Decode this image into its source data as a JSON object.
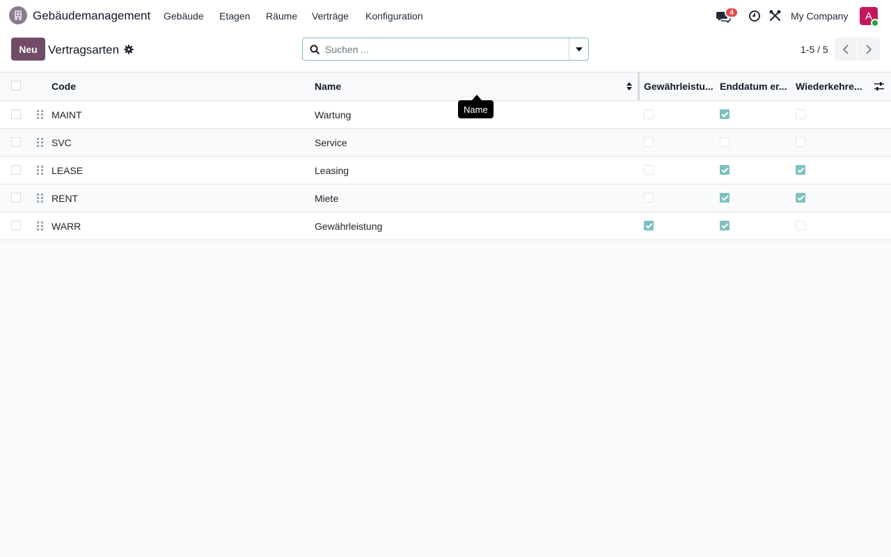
{
  "navbar": {
    "app_name": "Gebäudemanagement",
    "menu": [
      "Gebäude",
      "Etagen",
      "Räume",
      "Verträge",
      "Konfiguration"
    ],
    "chat_count": "4",
    "company": "My Company",
    "avatar_letter": "A"
  },
  "control": {
    "new_label": "Neu",
    "breadcrumb": "Vertragsarten",
    "search_placeholder": "Suchen ...",
    "pager": "1-5 / 5"
  },
  "table": {
    "columns": [
      "Code",
      "Name",
      "Gewährleistu...",
      "Enddatum er...",
      "Wiederkehre..."
    ],
    "rows": [
      {
        "code": "MAINT",
        "name": "Wartung",
        "warranty": false,
        "end_date": true,
        "recurring": false
      },
      {
        "code": "SVC",
        "name": "Service",
        "warranty": false,
        "end_date": false,
        "recurring": false
      },
      {
        "code": "LEASE",
        "name": "Leasing",
        "warranty": false,
        "end_date": true,
        "recurring": true
      },
      {
        "code": "RENT",
        "name": "Miete",
        "warranty": false,
        "end_date": true,
        "recurring": true
      },
      {
        "code": "WARR",
        "name": "Gewährleistung",
        "warranty": true,
        "end_date": true,
        "recurring": false
      }
    ]
  },
  "tooltip": "Name",
  "colors": {
    "primary": "#714b67",
    "checkbox_checked": "#7fbfc0",
    "badge": "#e5484d",
    "avatar": "#c2185b",
    "online": "#28a745"
  }
}
